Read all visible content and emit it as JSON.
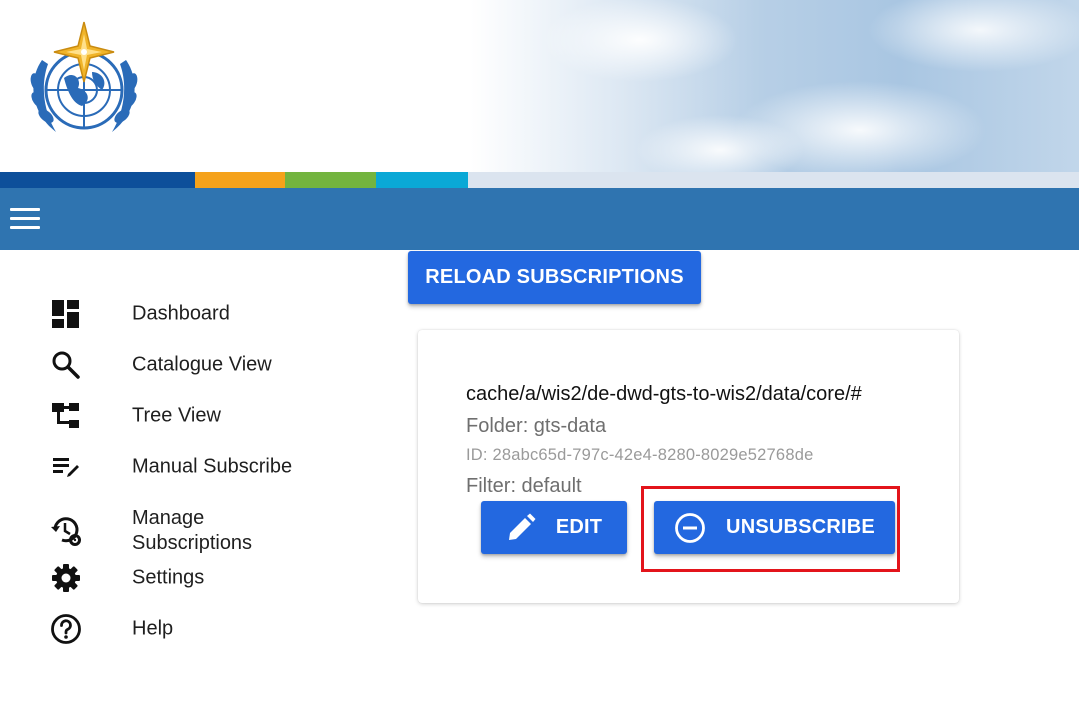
{
  "app": {
    "logo_icon": "wmo-emblem-logo",
    "menu_icon": "hamburger-menu-icon",
    "stripe_colors": [
      "#0d4f9a",
      "#f5a21b",
      "#73b43f",
      "#0aa8d6",
      "#dbe4ef"
    ],
    "appbar_color": "#2f74b0"
  },
  "nav": {
    "items": [
      {
        "label": "Dashboard",
        "icon": "dashboard-icon"
      },
      {
        "label": "Catalogue View",
        "icon": "search-icon"
      },
      {
        "label": "Tree View",
        "icon": "tree-view-icon"
      },
      {
        "label": "Manual Subscribe",
        "icon": "edit-list-icon"
      },
      {
        "label": "Manage\nSubscriptions",
        "icon": "history-settings-icon"
      },
      {
        "label": "Settings",
        "icon": "gear-icon"
      },
      {
        "label": "Help",
        "icon": "help-icon"
      }
    ]
  },
  "main": {
    "reload_label": "RELOAD SUBSCRIPTIONS",
    "subscription": {
      "topic": "cache/a/wis2/de-dwd-gts-to-wis2/data/core/#",
      "folder": "Folder: gts-data",
      "id": "ID: 28abc65d-797c-42e4-8280-8029e52768de",
      "filter": "Filter: default",
      "edit_label": "EDIT",
      "edit_icon": "pencil-icon",
      "unsubscribe_label": "UNSUBSCRIBE",
      "unsubscribe_icon": "minus-circle-icon"
    },
    "accent_color": "#2368e0",
    "highlight_color": "#e3141b"
  }
}
